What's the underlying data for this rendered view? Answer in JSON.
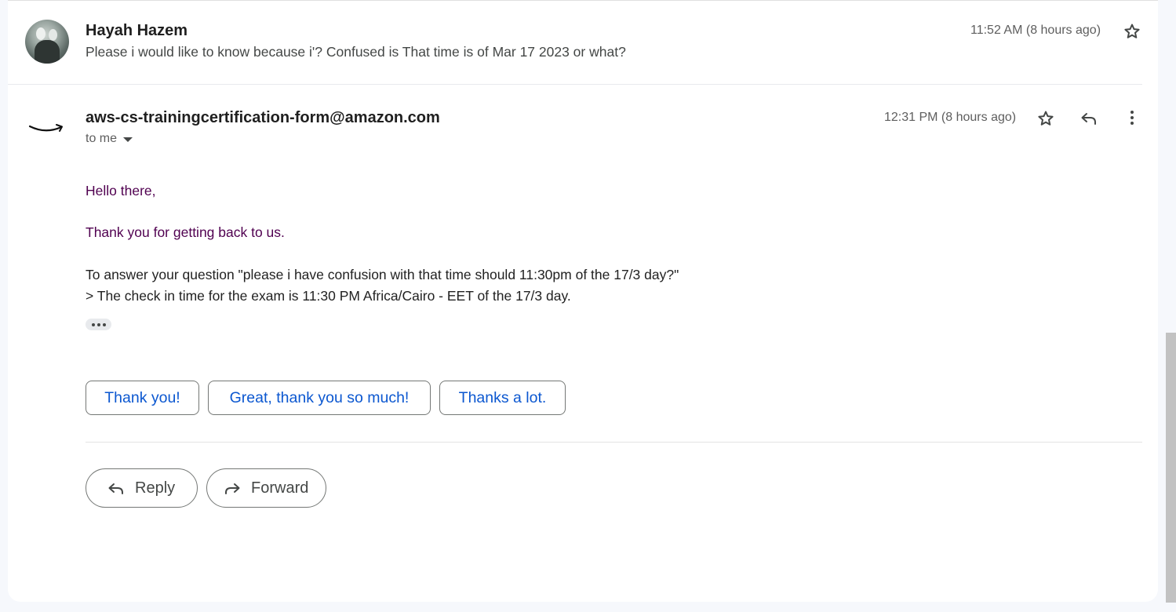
{
  "message1": {
    "sender": "Hayah Hazem",
    "snippet": "Please i would like to know because i'? Confused is That time is of Mar 17 2023 or what?",
    "time": "11:52 AM (8 hours ago)"
  },
  "message2": {
    "sender": "aws-cs-trainingcertification-form@amazon.com",
    "recipient": "to me",
    "time": "12:31 PM (8 hours ago)",
    "body": {
      "greeting": "Hello there,",
      "thanks": "Thank you for getting back to us.",
      "line1": "To answer your question \"please i have confusion with that time should 11:30pm of the 17/3 day?\"",
      "line2": "> The check in time for the exam is 11:30 PM Africa/Cairo - EET of the 17/3 day."
    }
  },
  "smart_replies": [
    "Thank you!",
    "Great, thank you so much!",
    "Thanks a lot."
  ],
  "actions": {
    "reply": "Reply",
    "forward": "Forward"
  },
  "icons": {
    "star": "star-outline-icon",
    "reply": "reply-arrow-icon",
    "more": "vertical-dots-icon",
    "forward": "forward-arrow-icon",
    "logo": "amazon-smile-logo"
  },
  "colors": {
    "link_blue": "#0b57d0",
    "quoted_purple": "#500050"
  }
}
